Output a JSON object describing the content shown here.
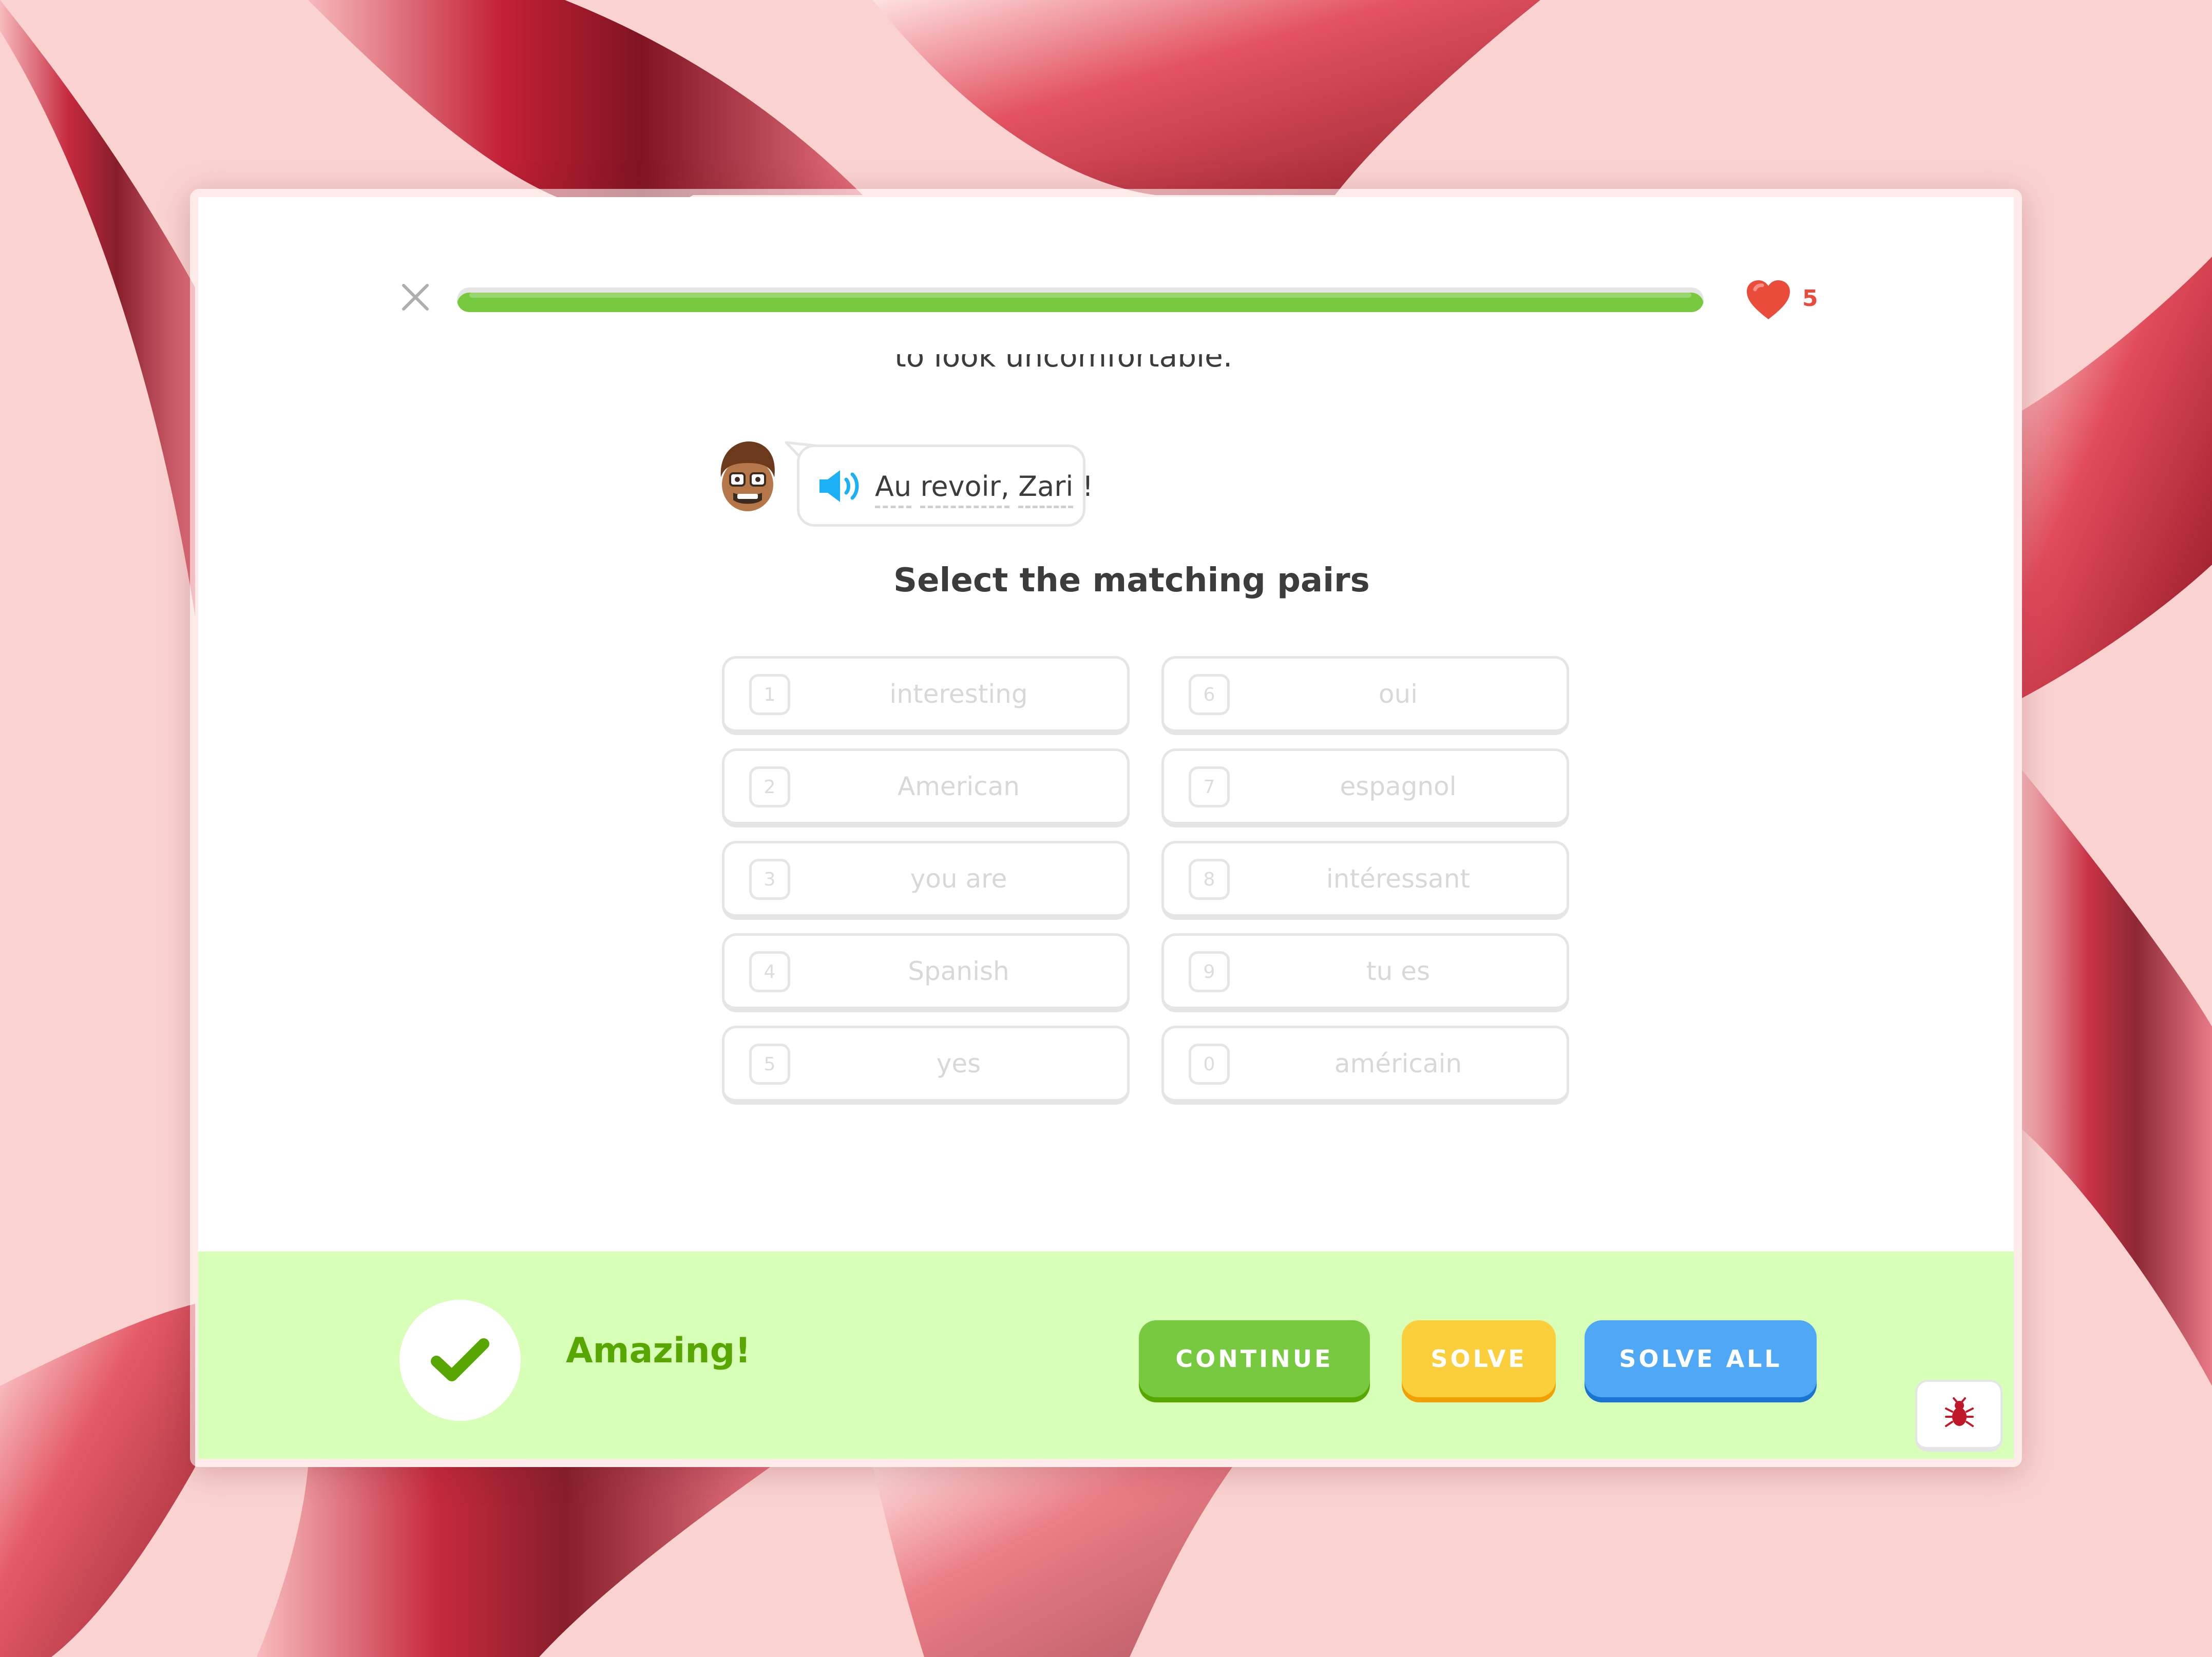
{
  "header": {
    "close_icon": "close-icon",
    "progress_percent": 100,
    "hearts_count": "5",
    "heart_color": "#ea4c3c"
  },
  "lesson": {
    "previous_sentence_fragment": "to look uncomfortable.",
    "speech_bubble": {
      "words": [
        "Au",
        "revoir,",
        "Zari",
        "!"
      ],
      "speaker_icon": "speaker-icon"
    },
    "instruction": "Select the matching pairs"
  },
  "pairs": {
    "left": [
      {
        "number": "1",
        "word": "interesting"
      },
      {
        "number": "2",
        "word": "American"
      },
      {
        "number": "3",
        "word": "you are"
      },
      {
        "number": "4",
        "word": "Spanish"
      },
      {
        "number": "5",
        "word": "yes"
      }
    ],
    "right": [
      {
        "number": "6",
        "word": "oui"
      },
      {
        "number": "7",
        "word": "espagnol"
      },
      {
        "number": "8",
        "word": "intéressant"
      },
      {
        "number": "9",
        "word": "tu es"
      },
      {
        "number": "0",
        "word": "américain"
      }
    ]
  },
  "footer": {
    "feedback": "Amazing!",
    "continue_label": "CONTINUE",
    "solve_label": "SOLVE",
    "solve_all_label": "SOLVE ALL",
    "bug_icon": "bug-icon",
    "colors": {
      "success": "#77c93f",
      "solve": "#fbcf3b",
      "solve_all": "#4fa8f5",
      "footer_bg": "#d7ffb8"
    }
  }
}
